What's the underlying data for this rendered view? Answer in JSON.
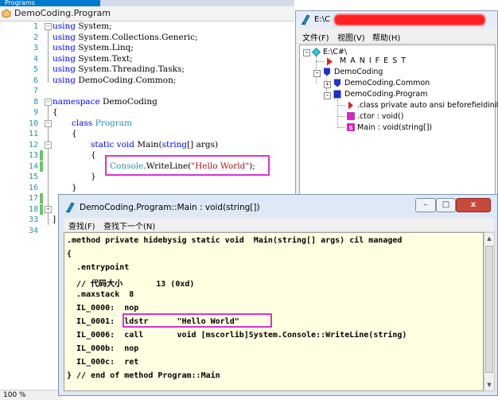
{
  "vs": {
    "tab_label": "Programs",
    "nav_path": "DemoCoding.Program",
    "zoom": "100 %",
    "line_numbers": [
      "1",
      "2",
      "3",
      "4",
      "5",
      "6",
      "7",
      "8",
      "9",
      "10",
      "11",
      "12",
      "13",
      "14",
      "15",
      "16",
      "17",
      "18",
      "33",
      "34"
    ],
    "code": {
      "using": "using",
      "ns_system": "System;",
      "ns_generic": "System.Collections.Generic;",
      "ns_linq": "System.Linq;",
      "ns_text": "System.Text;",
      "ns_tasks": "System.Threading.Tasks;",
      "ns_common": "DemoCoding.Common;",
      "namespace_kw": "namespace",
      "namespace_name": "DemoCoding",
      "open_brace": "{",
      "close_brace": "}",
      "class_kw": "class",
      "class_name": "Program",
      "static_kw": "static",
      "void_kw": "void",
      "main_name": "Main(",
      "string_kw": "string",
      "args": "[] args)",
      "console": "Console",
      "writeline": ".WriteLine(",
      "hello": "\"Hello World\"",
      "end_call": ");",
      "trailing_brace": "]"
    }
  },
  "ildasm_main": {
    "title_prefix": "E:\\C",
    "menu": [
      "文件(F)",
      "视图(V)",
      "帮助(H)"
    ],
    "tree": {
      "root": "E:\\C#\\",
      "manifest": "M A N I F E S T",
      "namespace": "DemoCoding",
      "common": "DemoCoding.Common",
      "program": "DemoCoding.Program",
      "class_decl": ".class private auto ansi beforefieldinit",
      "ctor": ".ctor : void()",
      "main": "Main : void(string[])"
    }
  },
  "method_window": {
    "title": "DemoCoding.Program::Main : void(string[])",
    "buttons": {
      "minimize": "–",
      "maximize": "□",
      "close": "x"
    },
    "menu": [
      "查找(F)",
      "查找下一个(N)"
    ],
    "il_lines": [
      ".method private hidebysig static void  Main(string[] args) cil managed",
      "{",
      "  .entrypoint",
      "  // 代码大小       13 (0xd)",
      "  .maxstack  8",
      "  IL_0000:  nop",
      "  IL_0001:  ldstr      \"Hello World\"",
      "  IL_0006:  call       void [mscorlib]System.Console::WriteLine(string)",
      "  IL_000b:  nop",
      "  IL_000c:  ret",
      "} // end of method Program::Main"
    ]
  },
  "colors": {
    "highlight": "#d633d6",
    "keyword": "#0000ff",
    "type": "#2b91af",
    "string": "#a31515",
    "il_background": "#ffffe1"
  }
}
